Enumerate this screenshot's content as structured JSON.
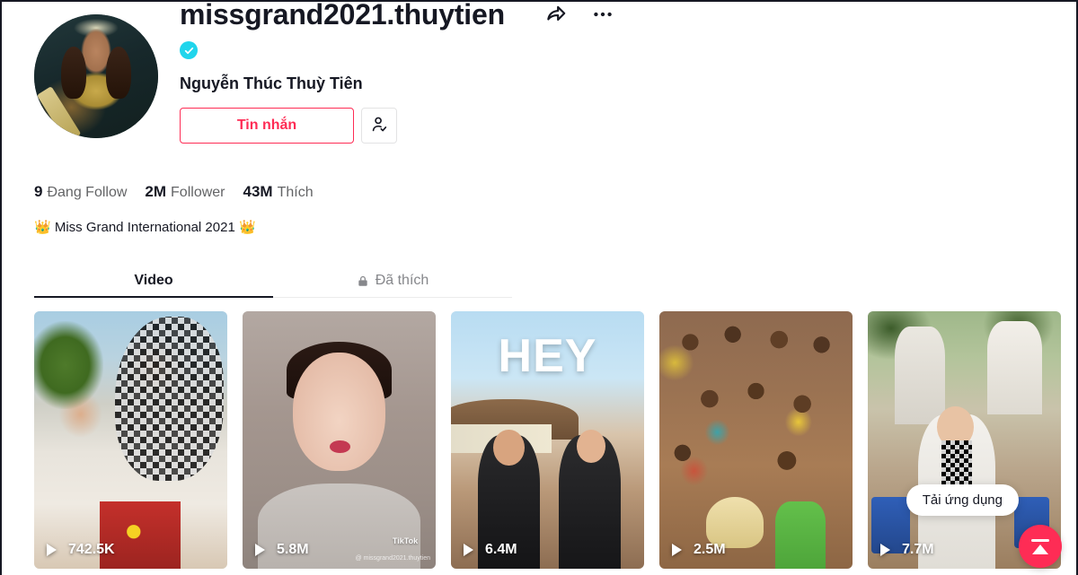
{
  "profile": {
    "username": "missgrand2021.thuytien",
    "display_name": "Nguyễn Thúc Thuỳ Tiên",
    "verified": true,
    "verified_icon": "verified-check-icon",
    "avatar_alt": "profile-avatar",
    "share_icon": "share-arrow-icon",
    "more_icon": "more-ellipsis-icon",
    "message_button": "Tin nhắn",
    "add_friend_icon": "person-check-icon",
    "bio": "👑 Miss Grand International 2021 👑"
  },
  "stats": [
    {
      "value": "9",
      "label": "Đang Follow",
      "name": "following"
    },
    {
      "value": "2M",
      "label": "Follower",
      "name": "followers"
    },
    {
      "value": "43M",
      "label": "Thích",
      "name": "likes"
    }
  ],
  "tabs": [
    {
      "label": "Video",
      "active": true,
      "icon": null
    },
    {
      "label": "Đã thích",
      "active": false,
      "icon": "lock-icon"
    }
  ],
  "videos": [
    {
      "views": "742.5K",
      "overlay_text": null,
      "watermark": false,
      "name": "video-card-1"
    },
    {
      "views": "5.8M",
      "overlay_text": null,
      "watermark": true,
      "watermark_label": "TikTok",
      "handle": "@ missgrand2021.thuytien",
      "name": "video-card-2"
    },
    {
      "views": "6.4M",
      "overlay_text": "HEY",
      "watermark": false,
      "name": "video-card-3"
    },
    {
      "views": "2.5M",
      "overlay_text": null,
      "watermark": false,
      "name": "video-card-4"
    },
    {
      "views": "7.7M",
      "overlay_text": null,
      "watermark": false,
      "name": "video-card-5"
    }
  ],
  "floating": {
    "download_tooltip": "Tải ứng dụng",
    "fab_icon": "upload-to-top-icon"
  },
  "colors": {
    "accent": "#fe2c55",
    "verified_blue": "#20D5EC",
    "text_primary": "#161823",
    "text_secondary": "#636466",
    "divider": "#ebebec"
  }
}
